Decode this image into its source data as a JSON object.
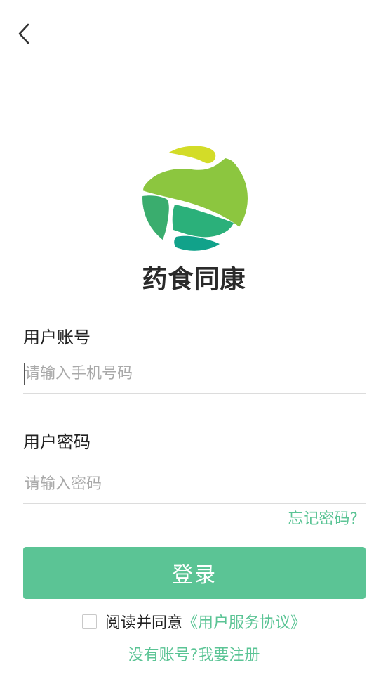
{
  "header": {
    "back_icon": "chevron-left-icon"
  },
  "brand": {
    "app_name": "药食同康",
    "logo_colors": [
      "#d3dc28",
      "#8cc63f",
      "#3aad6e",
      "#2bb07a",
      "#11a28a"
    ]
  },
  "form": {
    "account": {
      "label": "用户账号",
      "placeholder": "请输入手机号码",
      "value": ""
    },
    "password": {
      "label": "用户密码",
      "placeholder": "请输入密码",
      "value": ""
    },
    "forgot_label": "忘记密码?",
    "login_label": "登录"
  },
  "agreement": {
    "checked": false,
    "prefix": "阅读并同意",
    "link_label": "《用户服务协议》"
  },
  "register_label": "没有账号?我要注册",
  "colors": {
    "accent": "#5bc495",
    "text": "#222222",
    "placeholder": "#a9a9a9",
    "divider": "#dcdcdc"
  }
}
